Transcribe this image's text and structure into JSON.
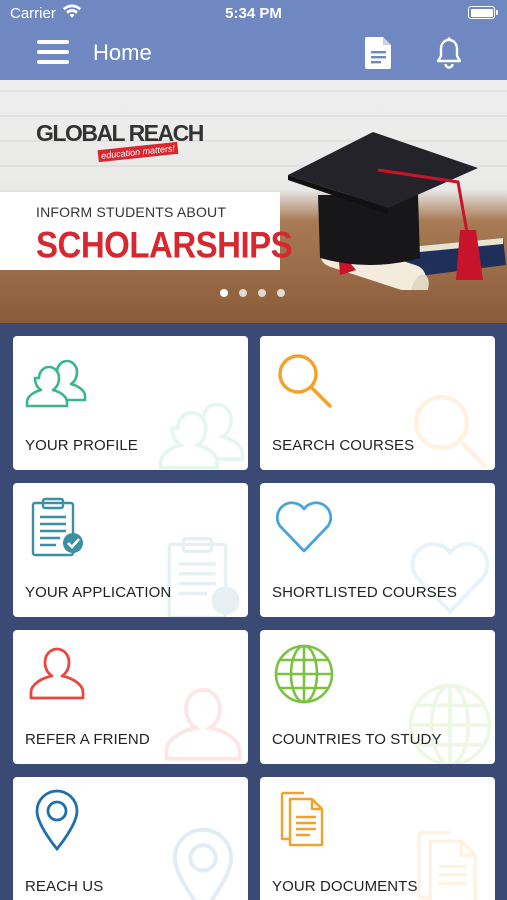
{
  "status_bar": {
    "carrier": "Carrier",
    "time": "5:34 PM"
  },
  "nav": {
    "title": "Home",
    "menu_icon": "hamburger-menu-icon",
    "doc_icon": "document-icon",
    "bell_icon": "bell-icon"
  },
  "banner": {
    "logo_text": "GLOBAL REACH",
    "logo_tagline": "education matters!",
    "caption_small": "INFORM STUDENTS ABOUT",
    "caption_big": "SCHOLARSHIPS",
    "slide_count": 4,
    "active_slide": 1
  },
  "tiles": [
    {
      "label": "YOUR PROFILE",
      "icon": "profile-icon",
      "color": "#3bb58f"
    },
    {
      "label": "SEARCH COURSES",
      "icon": "search-icon",
      "color": "#f2a12a"
    },
    {
      "label": "YOUR APPLICATION",
      "icon": "clipboard-icon",
      "color": "#3d8fa3"
    },
    {
      "label": "SHORTLISTED COURSES",
      "icon": "heart-icon",
      "color": "#4aa3d8"
    },
    {
      "label": "REFER A FRIEND",
      "icon": "person-icon",
      "color": "#e8483f"
    },
    {
      "label": "COUNTRIES TO STUDY",
      "icon": "globe-icon",
      "color": "#7cc242"
    },
    {
      "label": "REACH US",
      "icon": "location-pin-icon",
      "color": "#1f6fae"
    },
    {
      "label": "YOUR DOCUMENTS",
      "icon": "documents-icon",
      "color": "#f2a12a"
    }
  ],
  "colors": {
    "nav_bar": "#6f88c2",
    "background": "#3a4a75",
    "brand_red": "#d7282f"
  }
}
